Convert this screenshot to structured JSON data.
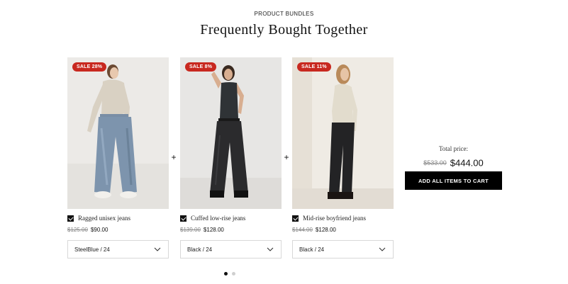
{
  "section": {
    "eyebrow": "PRODUCT BUNDLES",
    "title": "Frequently Bought Together"
  },
  "products": [
    {
      "badge": "SALE 28%",
      "name": "Ragged unisex jeans",
      "old_price": "$125.00",
      "price": "$90.00",
      "variant": "SteelBlue / 24",
      "checked": true,
      "image": "model-in-light-top-and-blue-wide-leg-jeans"
    },
    {
      "badge": "SALE 8%",
      "name": "Cuffed low-rise jeans",
      "old_price": "$139.00",
      "price": "$128.00",
      "variant": "Black / 24",
      "checked": true,
      "image": "model-in-black-tank-and-black-wide-leg-jeans"
    },
    {
      "badge": "SALE 11%",
      "name": "Mid-rise boyfriend jeans",
      "old_price": "$144.00",
      "price": "$128.00",
      "variant": "Black / 24",
      "checked": true,
      "image": "model-in-cream-top-and-black-boyfriend-jeans"
    }
  ],
  "separator": "+",
  "total": {
    "label": "Total price:",
    "old_price": "$533.00",
    "price": "$444.00",
    "cta_label": "ADD ALL ITEMS TO CART"
  },
  "pagination": {
    "pages": 2,
    "active": 1
  },
  "colors": {
    "badge": "#c8281f",
    "cta": "#000000",
    "accent_text": "#111111"
  }
}
